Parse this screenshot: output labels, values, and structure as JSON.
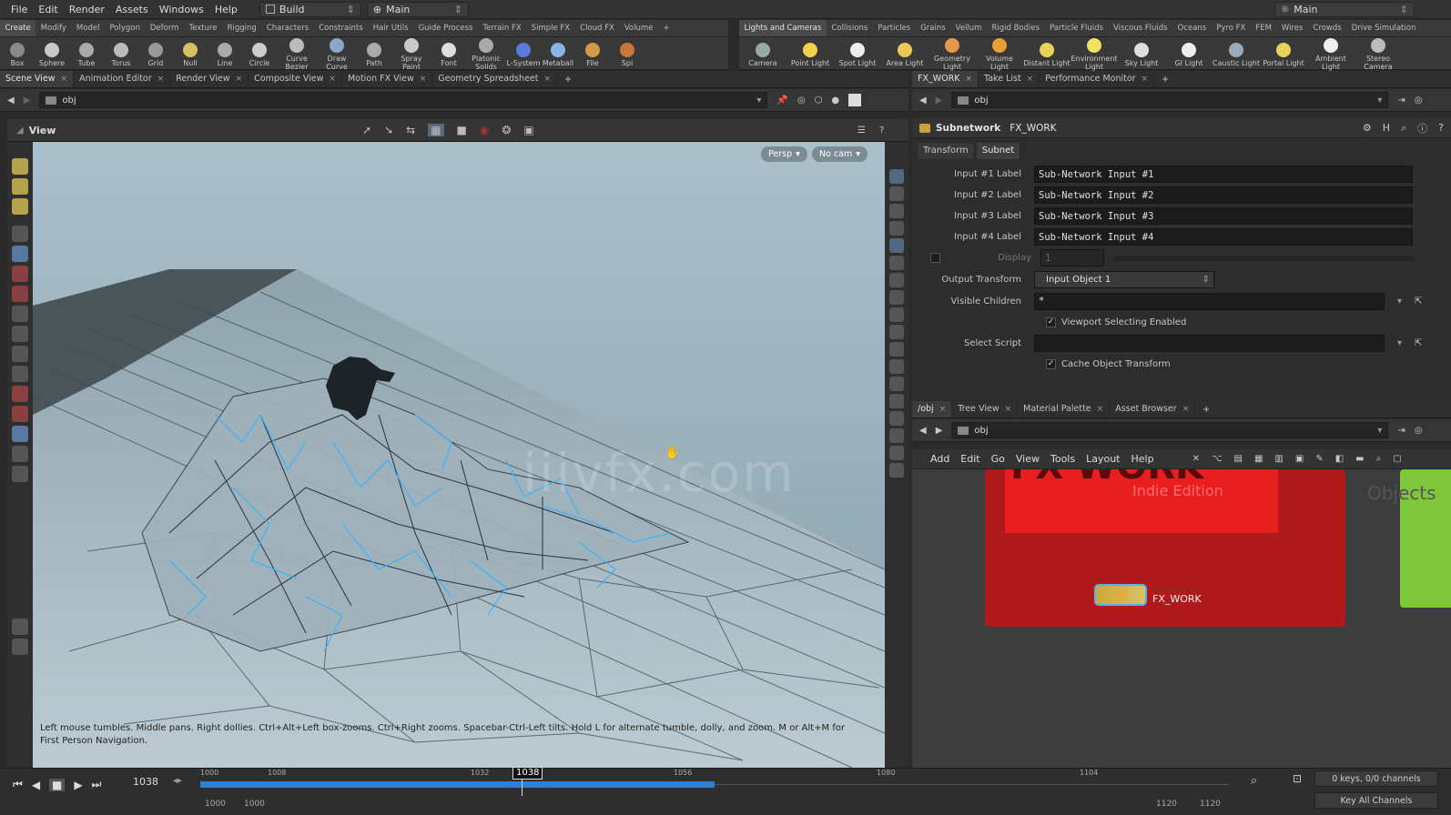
{
  "menubar": {
    "items": [
      "File",
      "Edit",
      "Render",
      "Assets",
      "Windows",
      "Help"
    ],
    "desktop": "Build",
    "main": "Main",
    "right_desktop": "Main"
  },
  "shelf_tabs_left": [
    "Create",
    "Modify",
    "Model",
    "Polygon",
    "Deform",
    "Texture",
    "Rigging",
    "Characters",
    "Constraints",
    "Hair Utils",
    "Guide Process",
    "Terrain FX",
    "Simple FX",
    "Cloud FX",
    "Volume"
  ],
  "shelf_tabs_right": [
    "Lights and Cameras",
    "Collisions",
    "Particles",
    "Grains",
    "Vellum",
    "Rigid Bodies",
    "Particle Fluids",
    "Viscous Fluids",
    "Oceans",
    "Pyro FX",
    "FEM",
    "Wires",
    "Crowds",
    "Drive Simulation"
  ],
  "tools_left": [
    "Box",
    "Sphere",
    "Tube",
    "Torus",
    "Grid",
    "Null",
    "Line",
    "Circle",
    "Curve Bezier",
    "Draw Curve",
    "Path",
    "Spray Paint",
    "Font",
    "Platonic Solids",
    "L-System",
    "Metaball",
    "File",
    "Spi"
  ],
  "tools_right": [
    "Camera",
    "Point Light",
    "Spot Light",
    "Area Light",
    "Geometry Light",
    "Volume Light",
    "Distant Light",
    "Environment Light",
    "Sky Light",
    "GI Light",
    "Caustic Light",
    "Portal Light",
    "Ambient Light",
    "Stereo Camera"
  ],
  "pane_tabs_left": [
    "Scene View",
    "Animation Editor",
    "Render View",
    "Composite View",
    "Motion FX View",
    "Geometry Spreadsheet"
  ],
  "pane_tabs_right": [
    "FX_WORK",
    "Take List",
    "Performance Monitor"
  ],
  "path_left": "obj",
  "path_right": "obj",
  "viewport": {
    "title": "View",
    "persp": "Persp",
    "cam": "No cam",
    "hint": "Left mouse tumbles. Middle pans. Right dollies. Ctrl+Alt+Left box-zooms. Ctrl+Right zooms. Spacebar-Ctrl-Left tilts. Hold L for alternate tumble, dolly, and zoom.    M or Alt+M for First Person Navigation.",
    "watermark": "iiivfx.com"
  },
  "params": {
    "node_type": "Subnetwork",
    "node_name": "FX_WORK",
    "tabs": [
      "Transform",
      "Subnet"
    ],
    "rows": [
      {
        "label": "Input #1 Label",
        "value": "Sub-Network Input #1"
      },
      {
        "label": "Input #2 Label",
        "value": "Sub-Network Input #2"
      },
      {
        "label": "Input #3 Label",
        "value": "Sub-Network Input #3"
      },
      {
        "label": "Input #4 Label",
        "value": "Sub-Network Input #4"
      }
    ],
    "display_label": "Display",
    "display_value": "1",
    "output_transform_label": "Output Transform",
    "output_transform_value": "Input Object 1",
    "visible_children_label": "Visible Children",
    "visible_children_value": "*",
    "viewport_selecting": "Viewport Selecting Enabled",
    "select_script_label": "Select Script",
    "cache_transform": "Cache Object Transform"
  },
  "network": {
    "tabs": [
      "/obj",
      "Tree View",
      "Material Palette",
      "Asset Browser"
    ],
    "menu": [
      "Add",
      "Edit",
      "Go",
      "View",
      "Tools",
      "Layout",
      "Help"
    ],
    "box_title": "FX WORK",
    "box_subtitle": "Indie Edition",
    "node_type": "Subnetwork",
    "node_name": "FX_WORK",
    "objects_label": "Objects"
  },
  "timeline": {
    "frame": "1038",
    "marker": "1038",
    "ticks": [
      "1000",
      "1008",
      "1032",
      "1056",
      "1080",
      "1104"
    ],
    "keys": "0 keys, 0/0 channels",
    "key_all": "Key All Channels",
    "start": "1000",
    "start2": "1000",
    "end": "1120",
    "end2": "1120"
  },
  "colors": {
    "accent_blue": "#2e7fd6",
    "network_red": "#c41a1a",
    "network_green": "#7ec63a"
  }
}
